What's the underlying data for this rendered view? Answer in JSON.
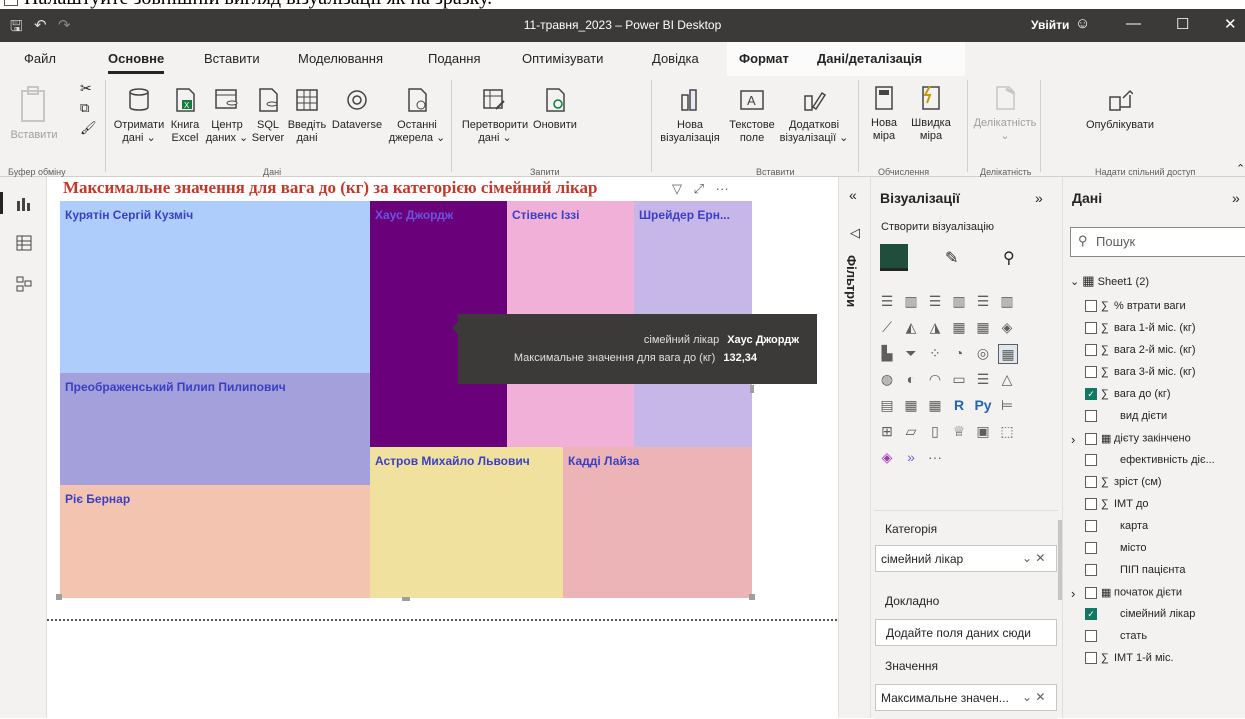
{
  "instruction": "Налаштуйте зовнішній вигляд візуалізації як на зразку.",
  "titlebar": {
    "doc_title": "11-травня_2023 – Power BI Desktop",
    "signin": "Увійти"
  },
  "menu_tabs": [
    "Файл",
    "Основне",
    "Вставити",
    "Моделювання",
    "Подання",
    "Оптимізувати",
    "Довідка",
    "Формат",
    "Дані/деталізація"
  ],
  "ribbon": {
    "paste": "Вставити",
    "clipboard_group": "Буфер обміну",
    "get_data": [
      "Отримати",
      "дані ⌄"
    ],
    "excel": [
      "Книга",
      "Excel"
    ],
    "data_hub": [
      "Центр",
      "даних ⌄"
    ],
    "sql": [
      "SQL",
      "Server"
    ],
    "enter_data": [
      "Введіть",
      "дані"
    ],
    "dataverse": "Dataverse",
    "recent": [
      "Останні",
      "джерела ⌄"
    ],
    "data_group": "Дані",
    "transform": [
      "Перетворити",
      "дані ⌄"
    ],
    "refresh": "Оновити",
    "queries_group": "Запити",
    "new_visual": [
      "Нова",
      "візуалізація"
    ],
    "text_box": [
      "Текстове",
      "поле"
    ],
    "more_visuals": [
      "Додаткові",
      "візуалізації ⌄"
    ],
    "insert_group": "Вставити",
    "new_measure": [
      "Нова",
      "міра"
    ],
    "quick_measure": [
      "Швидка",
      "міра"
    ],
    "calc_group": "Обчислення",
    "sensitivity": "Делікатність",
    "sensitivity_group": "Делікатність",
    "publish": "Опублікувати",
    "share_group": "Надати спільний доступ"
  },
  "visual": {
    "title": "Максимальне значення для вага до (кг) за категорією сімейний лікар",
    "header_icons": "▽  ⤢  ···",
    "tiles": [
      {
        "label": "Курятін Сергій Кузміч",
        "color": "#aecdfb",
        "text": "#3a3fc4"
      },
      {
        "label": "Хаус Джордж",
        "color": "#6b007b",
        "text": "#6b52e0"
      },
      {
        "label": "Стівенс Іззі",
        "color": "#f0b0d8",
        "text": "#3a3fc4"
      },
      {
        "label": "Шрейдер Ерн...",
        "color": "#c7b6e8",
        "text": "#3a3fc4"
      },
      {
        "label": "Преображенський Пилип Пилипович",
        "color": "#a3a0db",
        "text": "#3a3fc4"
      },
      {
        "label": "Астров Михайло Львович",
        "color": "#f1e19e",
        "text": "#3a3fc4"
      },
      {
        "label": "Кадді Лайза",
        "color": "#ecb4b6",
        "text": "#3a3fc4"
      },
      {
        "label": "Ріє Бернар",
        "color": "#f3c5b0",
        "text": "#3a3fc4"
      }
    ]
  },
  "tooltip": {
    "row1_key": "сімейний лікар",
    "row1_val": "Хаус Джордж",
    "row2_key": "Максимальне значення для вага до (кг)",
    "row2_val": "132,34"
  },
  "filters_label": "Фільтри",
  "viz_pane": {
    "title": "Візуалізації",
    "create": "Створити візуалізацію",
    "category_label": "Категорія",
    "category_value": "сімейний лікар",
    "details_label": "Докладно",
    "details_placeholder": "Додайте поля даних сюди",
    "values_label": "Значення",
    "values_value": "Максимальне значен..."
  },
  "data_pane": {
    "title": "Дані",
    "search_placeholder": "Пошук",
    "table": "Sheet1 (2)",
    "fields": [
      {
        "name": "% втрати ваги",
        "sigma": true,
        "checked": false,
        "table": false
      },
      {
        "name": "вага 1-й міс. (кг)",
        "sigma": true,
        "checked": false,
        "table": false
      },
      {
        "name": "вага 2-й міс. (кг)",
        "sigma": true,
        "checked": false,
        "table": false
      },
      {
        "name": "вага 3-й міс. (кг)",
        "sigma": true,
        "checked": false,
        "table": false
      },
      {
        "name": "вага до (кг)",
        "sigma": true,
        "checked": true,
        "table": false
      },
      {
        "name": "вид дієти",
        "sigma": false,
        "checked": false,
        "table": false
      },
      {
        "name": "дієту закінчено",
        "sigma": false,
        "checked": false,
        "table": true
      },
      {
        "name": "ефективність діє...",
        "sigma": false,
        "checked": false,
        "table": false
      },
      {
        "name": "зріст (см)",
        "sigma": true,
        "checked": false,
        "table": false
      },
      {
        "name": "ІМТ до",
        "sigma": true,
        "checked": false,
        "table": false
      },
      {
        "name": "карта",
        "sigma": false,
        "checked": false,
        "table": false
      },
      {
        "name": "місто",
        "sigma": false,
        "checked": false,
        "table": false
      },
      {
        "name": "ПІП пацієнта",
        "sigma": false,
        "checked": false,
        "table": false
      },
      {
        "name": "початок дієти",
        "sigma": false,
        "checked": false,
        "table": true
      },
      {
        "name": "сімейний лікар",
        "sigma": false,
        "checked": true,
        "table": false
      },
      {
        "name": "стать",
        "sigma": false,
        "checked": false,
        "table": false
      },
      {
        "name": "ІМТ 1-й міс.",
        "sigma": true,
        "checked": false,
        "table": false
      }
    ]
  }
}
